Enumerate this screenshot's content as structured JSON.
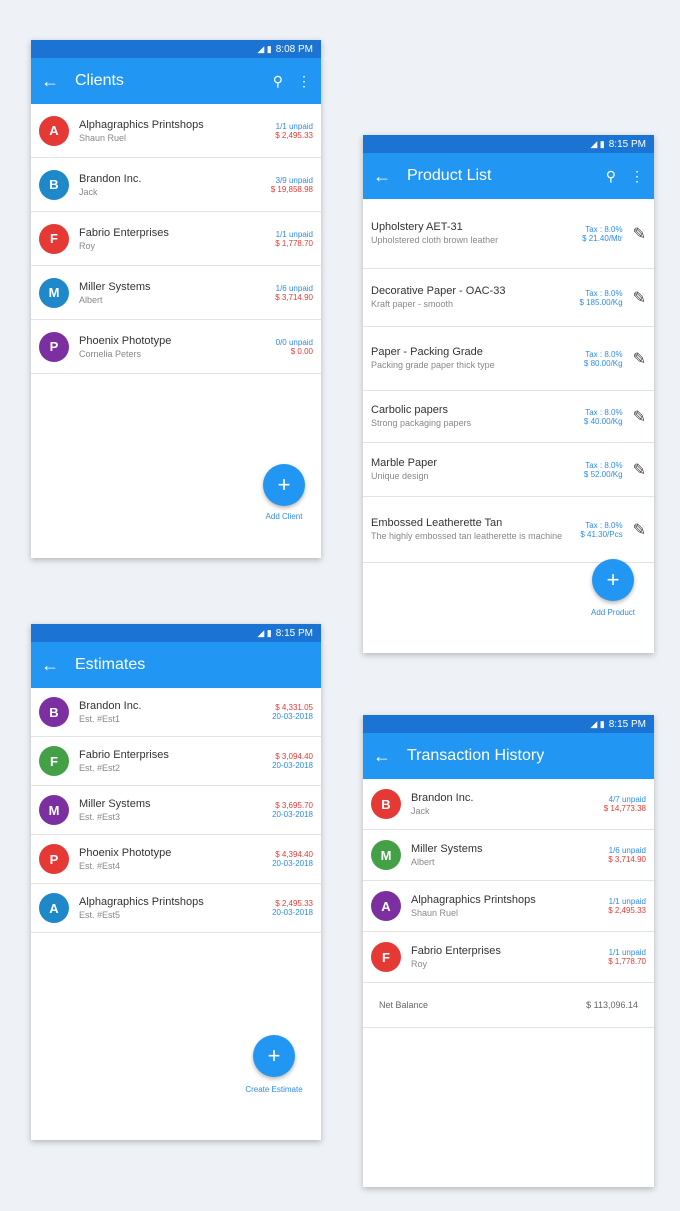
{
  "status": {
    "time_clients": "8:08 PM",
    "time_other": "8:15 PM"
  },
  "clients": {
    "title": "Clients",
    "items": [
      {
        "initial": "A",
        "color": "#e53935",
        "name": "Alphagraphics Printshops",
        "person": "Shaun Ruel",
        "paid": "1/1 unpaid",
        "amount": "$ 2,495.33"
      },
      {
        "initial": "B",
        "color": "#1e88c8",
        "name": "Brandon Inc.",
        "person": "Jack",
        "paid": "3/9 unpaid",
        "amount": "$ 19,858.98"
      },
      {
        "initial": "F",
        "color": "#e53935",
        "name": "Fabrio Enterprises",
        "person": "Roy",
        "paid": "1/1 unpaid",
        "amount": "$ 1,778.70"
      },
      {
        "initial": "M",
        "color": "#1e88c8",
        "name": "Miller Systems",
        "person": "Albert",
        "paid": "1/6 unpaid",
        "amount": "$ 3,714.90"
      },
      {
        "initial": "P",
        "color": "#7b2fa0",
        "name": "Phoenix Phototype",
        "person": "Cornelia Peters",
        "paid": "0/0 unpaid",
        "amount": "$ 0.00"
      }
    ],
    "fab_label": "Add Client"
  },
  "products": {
    "title": "Product List",
    "items": [
      {
        "name": "Upholstery AET-31",
        "desc": "Upholstered cloth brown leather",
        "tax": "Tax : 8.0%",
        "price": "$ 21.40/Mtr"
      },
      {
        "name": "Decorative Paper - OAC-33",
        "desc": "Kraft paper - smooth",
        "tax": "Tax : 8.0%",
        "price": "$ 185.00/Kg"
      },
      {
        "name": "Paper - Packing Grade",
        "desc": "Packing grade paper thick type",
        "tax": "Tax : 8.0%",
        "price": "$ 80.00/Kg"
      },
      {
        "name": "Carbolic papers",
        "desc": "Strong packaging papers",
        "tax": "Tax : 8.0%",
        "price": "$ 40.00/Kg"
      },
      {
        "name": "Marble Paper",
        "desc": "Unique design",
        "tax": "Tax : 8.0%",
        "price": "$ 52.00/Kg"
      },
      {
        "name": "Embossed Leatherette Tan",
        "desc": "The highly embossed tan leatherette is machine",
        "tax": "Tax : 8.0%",
        "price": "$ 41.30/Pcs"
      }
    ],
    "fab_label": "Add Product"
  },
  "estimates": {
    "title": "Estimates",
    "items": [
      {
        "initial": "B",
        "color": "#7b2fa0",
        "name": "Brandon Inc.",
        "est": "Est. #Est1",
        "amount": "$ 4,331.05",
        "date": "20-03-2018"
      },
      {
        "initial": "F",
        "color": "#43a047",
        "name": "Fabrio Enterprises",
        "est": "Est. #Est2",
        "amount": "$ 3,094.40",
        "date": "20-03-2018"
      },
      {
        "initial": "M",
        "color": "#7b2fa0",
        "name": "Miller Systems",
        "est": "Est. #Est3",
        "amount": "$ 3,695.70",
        "date": "20-03-2018"
      },
      {
        "initial": "P",
        "color": "#e53935",
        "name": "Phoenix Phototype",
        "est": "Est. #Est4",
        "amount": "$ 4,394.40",
        "date": "20-03-2018"
      },
      {
        "initial": "A",
        "color": "#1e88c8",
        "name": "Alphagraphics Printshops",
        "est": "Est. #Est5",
        "amount": "$ 2,495.33",
        "date": "20-03-2018"
      }
    ],
    "fab_label": "Create Estimate"
  },
  "transactions": {
    "title": "Transaction History",
    "items": [
      {
        "initial": "B",
        "color": "#e53935",
        "name": "Brandon Inc.",
        "person": "Jack",
        "paid": "4/7 unpaid",
        "amount": "$ 14,773.38"
      },
      {
        "initial": "M",
        "color": "#43a047",
        "name": "Miller Systems",
        "person": "Albert",
        "paid": "1/6 unpaid",
        "amount": "$ 3,714.90"
      },
      {
        "initial": "A",
        "color": "#7b2fa0",
        "name": "Alphagraphics Printshops",
        "person": "Shaun Ruel",
        "paid": "1/1 unpaid",
        "amount": "$ 2,495.33"
      },
      {
        "initial": "F",
        "color": "#e53935",
        "name": "Fabrio Enterprises",
        "person": "Roy",
        "paid": "1/1 unpaid",
        "amount": "$ 1,778.70"
      }
    ],
    "net_label": "Net Balance",
    "net_value": "$ 113,096.14"
  }
}
